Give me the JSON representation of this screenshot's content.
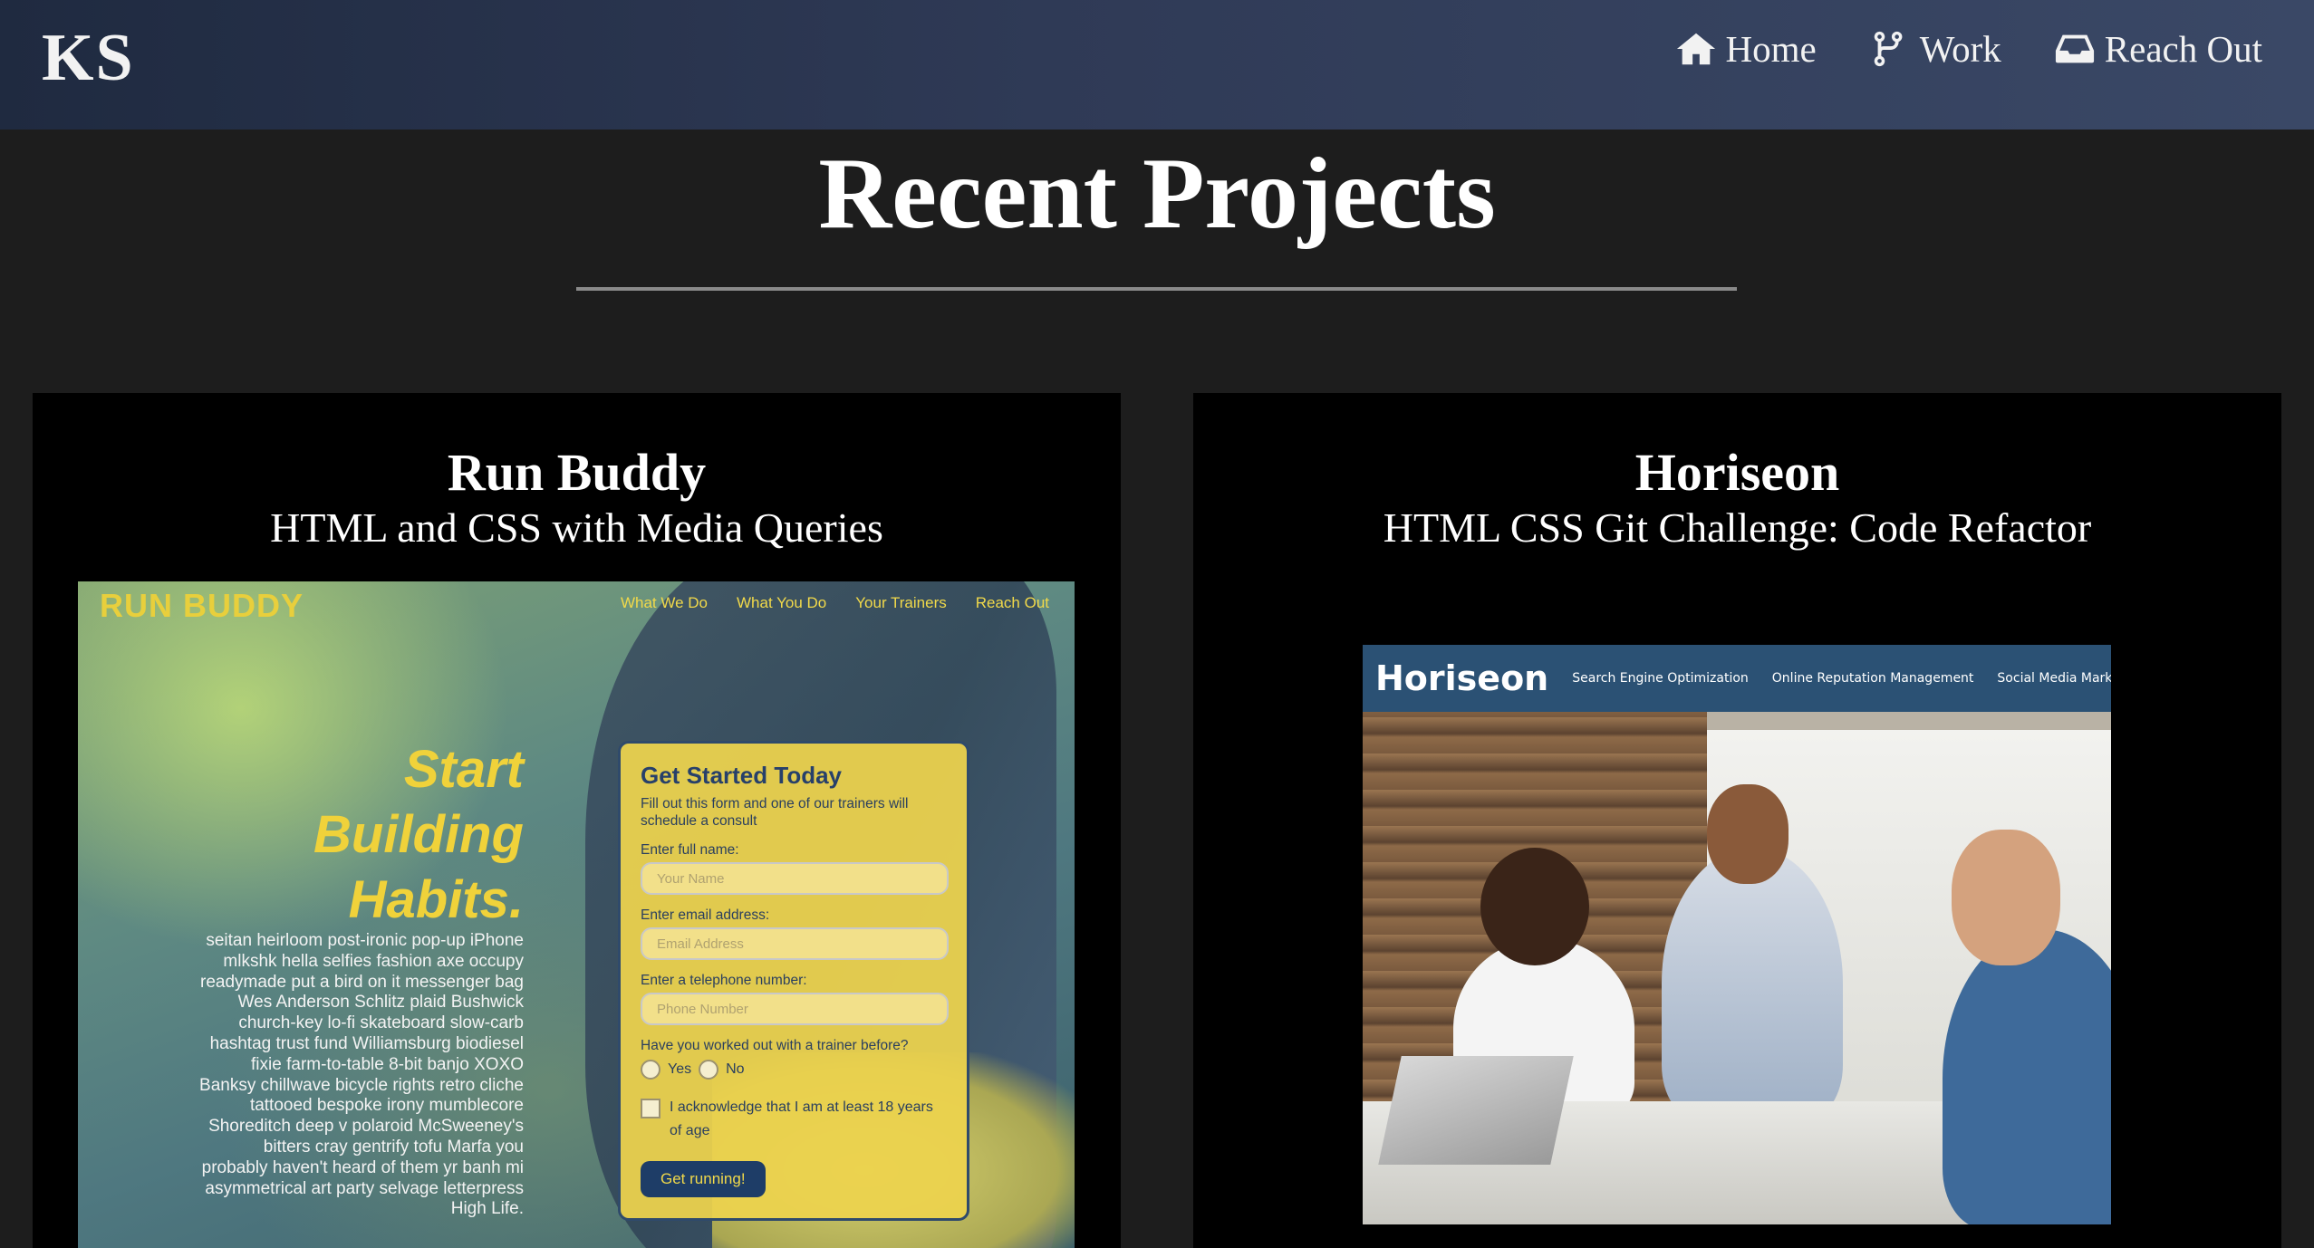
{
  "header": {
    "logo": "KS",
    "nav": [
      {
        "label": "Home",
        "icon": "home-icon"
      },
      {
        "label": "Work",
        "icon": "code-branch-icon"
      },
      {
        "label": "Reach Out",
        "icon": "inbox-icon"
      }
    ]
  },
  "main": {
    "title": "Recent Projects",
    "projects": [
      {
        "title": "Run Buddy",
        "subtitle": "HTML and CSS with Media Queries",
        "preview": {
          "logo": "RUN BUDDY",
          "nav": [
            "What We Do",
            "What You Do",
            "Your Trainers",
            "Reach Out"
          ],
          "hero_lines": [
            "Start",
            "Building",
            "Habits."
          ],
          "body_text": "seitan heirloom post-ironic pop-up iPhone mlkshk hella selfies fashion axe occupy readymade put a bird on it messenger bag Wes Anderson Schlitz plaid Bushwick church-key lo-fi skateboard slow-carb hashtag trust fund Williamsburg biodiesel fixie farm-to-table 8-bit banjo XOXO Banksy chillwave bicycle rights retro cliche tattooed bespoke irony mumblecore Shoreditch deep v polaroid McSweeney's bitters cray gentrify tofu Marfa you probably haven't heard of them yr banh mi asymmetrical art party selvage letterpress High Life.",
          "form": {
            "title": "Get Started Today",
            "description": "Fill out this form and one of our trainers will schedule a consult",
            "name_label": "Enter full name:",
            "name_placeholder": "Your Name",
            "email_label": "Enter email address:",
            "email_placeholder": "Email Address",
            "phone_label": "Enter a telephone number:",
            "phone_placeholder": "Phone Number",
            "question": "Have you worked out with a trainer before?",
            "yes": "Yes",
            "no": "No",
            "acknowledge": "I acknowledge that I am at least 18 years of age",
            "submit": "Get running!"
          },
          "colors": {
            "accent": "#f0d23a",
            "form": "#ecd24e",
            "button": "#1e3d67"
          }
        }
      },
      {
        "title": "Horiseon",
        "subtitle": "HTML CSS Git Challenge: Code Refactor",
        "preview": {
          "logo": "Horiseon",
          "nav": [
            "Search Engine Optimization",
            "Online Reputation Management",
            "Social Media Marketing"
          ],
          "colors": {
            "bar": "#2b5174"
          }
        }
      }
    ]
  },
  "colors": {
    "background": "#1d1d1d",
    "card": "#000000",
    "rule": "#8a8a8a",
    "header": "#2f3a56"
  }
}
